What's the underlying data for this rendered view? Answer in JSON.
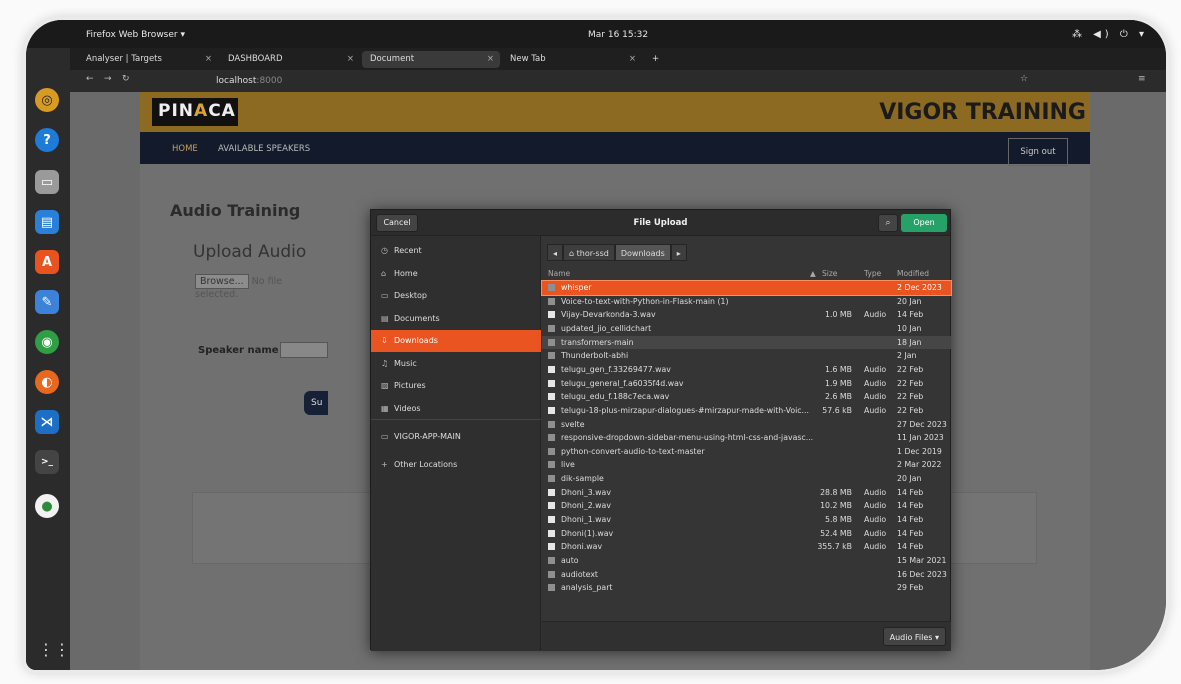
{
  "topbar": {
    "app": "Firefox Web Browser ▾",
    "clock": "Mar 16  15:32",
    "tray": "⁂ ◀) ⏻ ▾"
  },
  "tabs": [
    {
      "label": "Analyser | Targets"
    },
    {
      "label": "DASHBOARD"
    },
    {
      "label": "Document"
    },
    {
      "label": "New Tab"
    }
  ],
  "url": {
    "host": "localhost",
    "port": ":8000"
  },
  "site": {
    "logo_a": "PIN",
    "logo_b": "A",
    "logo_c": "CA",
    "brand_title": "VIGOR TRAINING",
    "nav_home": "HOME",
    "nav_speakers": "AVAILABLE SPEAKERS",
    "sign_out": "Sign out",
    "audio_title": "Audio Training",
    "upload_title": "Upload Audio",
    "browse_label": "Browse...",
    "no_file": "No file selected.",
    "speaker_label": "Speaker name",
    "submit_label": "Su"
  },
  "dialog": {
    "title": "File Upload",
    "cancel": "Cancel",
    "open": "Open",
    "filter": "Audio Files ▾",
    "places": [
      {
        "icon": "clock-icon",
        "glyph": "◷",
        "label": "Recent"
      },
      {
        "icon": "home-icon",
        "glyph": "⌂",
        "label": "Home"
      },
      {
        "icon": "desktop-icon",
        "glyph": "▭",
        "label": "Desktop"
      },
      {
        "icon": "documents-icon",
        "glyph": "▤",
        "label": "Documents"
      },
      {
        "icon": "downloads-icon",
        "glyph": "⇩",
        "label": "Downloads"
      },
      {
        "icon": "music-icon",
        "glyph": "♫",
        "label": "Music"
      },
      {
        "icon": "pictures-icon",
        "glyph": "▨",
        "label": "Pictures"
      },
      {
        "icon": "videos-icon",
        "glyph": "▦",
        "label": "Videos"
      },
      {
        "icon": "folder-icon",
        "glyph": "▭",
        "label": "VIGOR-APP-MAIN"
      },
      {
        "icon": "plus-icon",
        "glyph": "+",
        "label": "Other Locations"
      }
    ],
    "path": {
      "home": "thor-ssd",
      "current": "Downloads"
    },
    "columns": {
      "name": "Name",
      "size": "Size",
      "type": "Type",
      "modified": "Modified"
    },
    "files": [
      {
        "name": "whisper",
        "kind": "folder",
        "size": "",
        "type": "",
        "modified": "2 Dec 2023"
      },
      {
        "name": "Voice-to-text-with-Python-in-Flask-main (1)",
        "kind": "folder",
        "size": "",
        "type": "",
        "modified": "20 Jan"
      },
      {
        "name": "Vijay-Devarkonda-3.wav",
        "kind": "file",
        "size": "1.0 MB",
        "type": "Audio",
        "modified": "14 Feb"
      },
      {
        "name": "updated_jio_cellidchart",
        "kind": "folder",
        "size": "",
        "type": "",
        "modified": "10 Jan"
      },
      {
        "name": "transformers-main",
        "kind": "folder",
        "size": "",
        "type": "",
        "modified": "18 Jan"
      },
      {
        "name": "Thunderbolt-abhi",
        "kind": "folder",
        "size": "",
        "type": "",
        "modified": "2 Jan"
      },
      {
        "name": "telugu_gen_f.33269477.wav",
        "kind": "file",
        "size": "1.6 MB",
        "type": "Audio",
        "modified": "22 Feb"
      },
      {
        "name": "telugu_general_f.a6035f4d.wav",
        "kind": "file",
        "size": "1.9 MB",
        "type": "Audio",
        "modified": "22 Feb"
      },
      {
        "name": "telugu_edu_f.188c7eca.wav",
        "kind": "file",
        "size": "2.6 MB",
        "type": "Audio",
        "modified": "22 Feb"
      },
      {
        "name": "telugu-18-plus-mirzapur-dialogues-#mirzapur-made-with-Voic...",
        "kind": "file",
        "size": "57.6 kB",
        "type": "Audio",
        "modified": "22 Feb"
      },
      {
        "name": "svelte",
        "kind": "folder",
        "size": "",
        "type": "",
        "modified": "27 Dec 2023"
      },
      {
        "name": "responsive-dropdown-sidebar-menu-using-html-css-and-javasc...",
        "kind": "folder",
        "size": "",
        "type": "",
        "modified": "11 Jan 2023"
      },
      {
        "name": "python-convert-audio-to-text-master",
        "kind": "folder",
        "size": "",
        "type": "",
        "modified": "1 Dec 2019"
      },
      {
        "name": "live",
        "kind": "folder",
        "size": "",
        "type": "",
        "modified": "2 Mar 2022"
      },
      {
        "name": "dik-sample",
        "kind": "folder",
        "size": "",
        "type": "",
        "modified": "20 Jan"
      },
      {
        "name": "Dhoni_3.wav",
        "kind": "file",
        "size": "28.8 MB",
        "type": "Audio",
        "modified": "14 Feb"
      },
      {
        "name": "Dhoni_2.wav",
        "kind": "file",
        "size": "10.2 MB",
        "type": "Audio",
        "modified": "14 Feb"
      },
      {
        "name": "Dhoni_1.wav",
        "kind": "file",
        "size": "5.8 MB",
        "type": "Audio",
        "modified": "14 Feb"
      },
      {
        "name": "Dhoni(1).wav",
        "kind": "file",
        "size": "52.4 MB",
        "type": "Audio",
        "modified": "14 Feb"
      },
      {
        "name": "Dhoni.wav",
        "kind": "file",
        "size": "355.7 kB",
        "type": "Audio",
        "modified": "14 Feb"
      },
      {
        "name": "auto",
        "kind": "folder",
        "size": "",
        "type": "",
        "modified": "15 Mar 2021"
      },
      {
        "name": "audiotext",
        "kind": "folder",
        "size": "",
        "type": "",
        "modified": "16 Dec 2023"
      },
      {
        "name": "analysis_part",
        "kind": "folder",
        "size": "",
        "type": "",
        "modified": "29 Feb"
      }
    ],
    "selected_index": 0,
    "hover_index": 4,
    "active_place_index": 4
  },
  "colors": {
    "accent": "#e95420",
    "open_button": "#26a269",
    "header_gold": "#8d6a21",
    "nav_dark": "#121a2b"
  }
}
